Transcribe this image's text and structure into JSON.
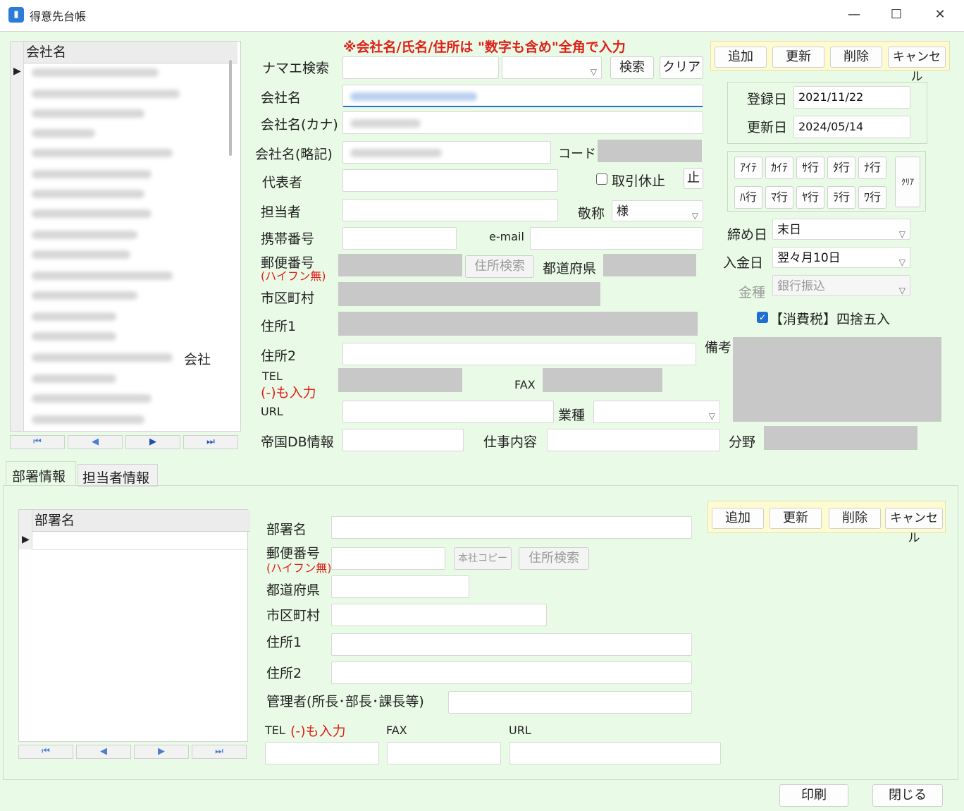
{
  "window": {
    "title": "得意先台帳",
    "app_icon": "app-icon",
    "minimize": "—",
    "maximize": "☐",
    "close": "✕"
  },
  "notice": "※会社名/氏名/住所は \"数字も含め\"全角で入力",
  "company_grid": {
    "header": "会社名",
    "row_fragment": "会社"
  },
  "nav": {
    "first": "⏮",
    "prev": "◀",
    "next": "▶",
    "last": "⏭"
  },
  "form": {
    "name_search_label": "ナマエ検索",
    "search_button": "検索",
    "clear_button": "クリア",
    "company_label": "会社名",
    "company_kana_label": "会社名(カナ)",
    "company_short_label": "会社名(略記)",
    "code_label": "コード",
    "rep_label": "代表者",
    "suspend_label": "取引休止",
    "stop_button": "止",
    "person_label": "担当者",
    "honorific_label": "敬称",
    "honorific_value": "様",
    "mobile_label": "携帯番号",
    "email_label": "e-mail",
    "zip_label": "郵便番号",
    "zip_note": "(ハイフン無)",
    "address_search_button": "住所検索",
    "pref_label": "都道府県",
    "city_label": "市区町村",
    "addr1_label": "住所1",
    "addr2_label": "住所2",
    "tel_label": "TEL",
    "tel_note": "(-)も入力",
    "fax_label": "FAX",
    "url_label": "URL",
    "industry_label": "業種",
    "teikoku_label": "帝国DB情報",
    "work_label": "仕事内容",
    "field_label": "分野"
  },
  "actions": {
    "add": "追加",
    "update": "更新",
    "delete": "削除",
    "cancel": "キャンセル"
  },
  "dates": {
    "registered_label": "登録日",
    "registered_value": "2021/11/22",
    "updated_label": "更新日",
    "updated_value": "2024/05/14"
  },
  "kana_buttons": [
    "ｱｲﾃ",
    "ｶｲﾃ",
    "ｻ行",
    "ﾀ行",
    "ﾅ行",
    "ﾊ行",
    "ﾏ行",
    "ﾔ行",
    "ﾗ行",
    "ﾜ行"
  ],
  "kana_clear": "ｸﾘｱ",
  "billing": {
    "closing_label": "締め日",
    "closing_value": "末日",
    "payment_label": "入金日",
    "payment_value": "翌々月10日",
    "type_label": "金種",
    "type_value": "銀行振込",
    "tax_label": "【消費税】四捨五入",
    "tax_checked": true,
    "remarks_label": "備考"
  },
  "tabs": [
    "部署情報",
    "担当者情報"
  ],
  "dept": {
    "grid_header": "部署名",
    "name_label": "部署名",
    "zip_label": "郵便番号",
    "zip_note": "(ハイフン無)",
    "head_copy_button": "本社コピー",
    "address_search_button": "住所検索",
    "pref_label": "都道府県",
    "city_label": "市区町村",
    "addr1_label": "住所1",
    "addr2_label": "住所2",
    "manager_label": "管理者(所長･部長･課長等)",
    "tel_label": "TEL",
    "tel_note": "(-)も入力",
    "fax_label": "FAX",
    "url_label": "URL"
  },
  "footer": {
    "print": "印刷",
    "close": "閉じる"
  }
}
